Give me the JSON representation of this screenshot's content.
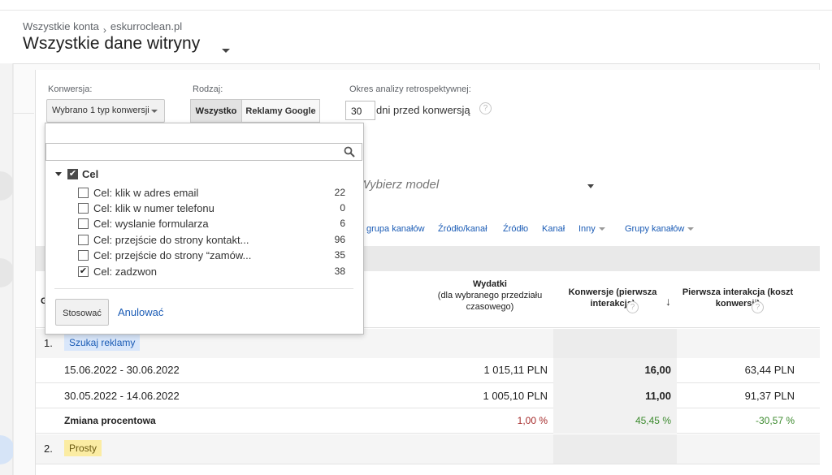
{
  "breadcrumb": {
    "root": "Wszystkie konta",
    "account": "eskurroclean.pl"
  },
  "page_title": "Wszystkie dane witryny",
  "filters": {
    "conversion_label": "Konwersja:",
    "conversion_value": "Wybrano 1 typ konwersji",
    "type_label": "Rodzaj:",
    "type_options": [
      "Wszystko",
      "Reklamy Google"
    ],
    "lookback_label": "Okres analizy retrospektywnej:",
    "lookback_value": "30",
    "lookback_suffix": "dni przed konwersją",
    "help_glyph": "?"
  },
  "model": {
    "placeholder": "Wybierz model"
  },
  "dimension_tabs": [
    "grupa kanałów",
    "Źródło/kanał",
    "Źródło",
    "Kanał",
    "Inny",
    "Grupy kanałów"
  ],
  "table": {
    "header_first_letter": "G",
    "columns": {
      "spend_title": "Wydatki",
      "spend_sub": "(dla wybranego przedziału czasowego)",
      "conversions": "Konwersje (pierwsza interakcja)",
      "first_interaction_cost": "Pierwsza interakcja (koszt konwersji)"
    },
    "groups": [
      {
        "index": "1.",
        "name": "Szukaj reklamy",
        "rows": [
          {
            "period": "15.06.2022 - 30.06.2022",
            "spend": "1 015,11 PLN",
            "conversions": "16,00",
            "cost": "63,44 PLN"
          },
          {
            "period": "30.05.2022 - 14.06.2022",
            "spend": "1 005,10 PLN",
            "conversions": "11,00",
            "cost": "91,37 PLN"
          }
        ],
        "change": {
          "label": "Zmiana procentowa",
          "spend": "1,00 %",
          "conversions": "45,45 %",
          "cost": "-30,57 %"
        }
      },
      {
        "index": "2.",
        "name": "Prosty"
      }
    ]
  },
  "dropdown": {
    "search_placeholder": "",
    "parent": "Cel",
    "items": [
      {
        "label": "Cel: klik w adres email",
        "count": "22",
        "checked": false
      },
      {
        "label": "Cel: klik w numer telefonu",
        "count": "0",
        "checked": false
      },
      {
        "label": "Cel: wyslanie formularza",
        "count": "6",
        "checked": false
      },
      {
        "label": "Cel: przejście do strony kontakt...",
        "count": "96",
        "checked": false
      },
      {
        "label": "Cel: przejście do strony “zamów...",
        "count": "35",
        "checked": false
      },
      {
        "label": "Cel: zadzwon",
        "count": "38",
        "checked": true
      }
    ],
    "apply": "Stosować",
    "cancel": "Anulować"
  },
  "colors": {
    "link": "#1a5bb5",
    "spend_change": "#a52a2a",
    "positive_change": "#3c8a2e",
    "chip_blue_bg": "#d9e7fb",
    "chip_yellow_bg": "#fbeca3"
  }
}
